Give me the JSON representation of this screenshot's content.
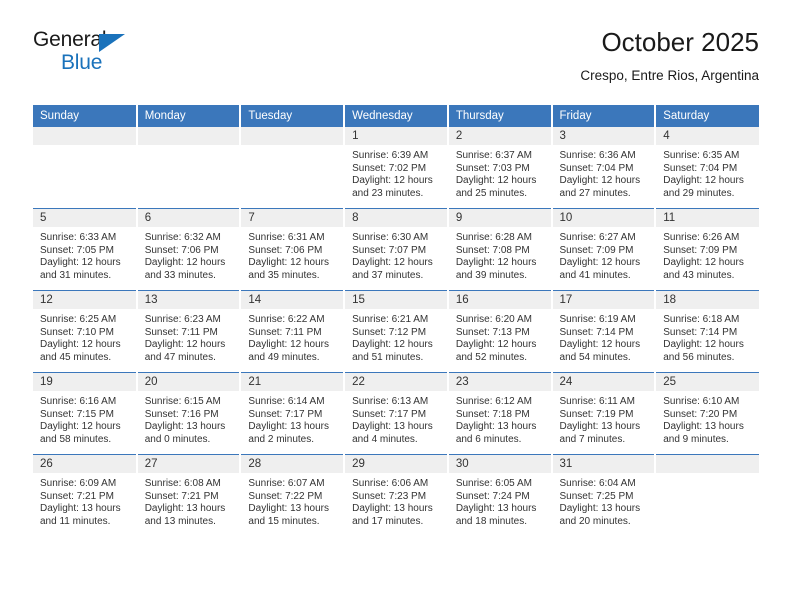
{
  "brand": {
    "name_part1": "General",
    "name_part2": "Blue",
    "accent_color": "#1a72bb"
  },
  "header": {
    "title": "October 2025",
    "subtitle": "Crespo, Entre Rios, Argentina"
  },
  "theme": {
    "header_blue": "#3b77bb",
    "daynum_gray": "#efefef"
  },
  "weekday_headers": [
    "Sunday",
    "Monday",
    "Tuesday",
    "Wednesday",
    "Thursday",
    "Friday",
    "Saturday"
  ],
  "weeks": [
    [
      {
        "day": "",
        "empty": true
      },
      {
        "day": "",
        "empty": true
      },
      {
        "day": "",
        "empty": true
      },
      {
        "day": "1",
        "sunrise": "Sunrise: 6:39 AM",
        "sunset": "Sunset: 7:02 PM",
        "daylight1": "Daylight: 12 hours",
        "daylight2": "and 23 minutes."
      },
      {
        "day": "2",
        "sunrise": "Sunrise: 6:37 AM",
        "sunset": "Sunset: 7:03 PM",
        "daylight1": "Daylight: 12 hours",
        "daylight2": "and 25 minutes."
      },
      {
        "day": "3",
        "sunrise": "Sunrise: 6:36 AM",
        "sunset": "Sunset: 7:04 PM",
        "daylight1": "Daylight: 12 hours",
        "daylight2": "and 27 minutes."
      },
      {
        "day": "4",
        "sunrise": "Sunrise: 6:35 AM",
        "sunset": "Sunset: 7:04 PM",
        "daylight1": "Daylight: 12 hours",
        "daylight2": "and 29 minutes."
      }
    ],
    [
      {
        "day": "5",
        "sunrise": "Sunrise: 6:33 AM",
        "sunset": "Sunset: 7:05 PM",
        "daylight1": "Daylight: 12 hours",
        "daylight2": "and 31 minutes."
      },
      {
        "day": "6",
        "sunrise": "Sunrise: 6:32 AM",
        "sunset": "Sunset: 7:06 PM",
        "daylight1": "Daylight: 12 hours",
        "daylight2": "and 33 minutes."
      },
      {
        "day": "7",
        "sunrise": "Sunrise: 6:31 AM",
        "sunset": "Sunset: 7:06 PM",
        "daylight1": "Daylight: 12 hours",
        "daylight2": "and 35 minutes."
      },
      {
        "day": "8",
        "sunrise": "Sunrise: 6:30 AM",
        "sunset": "Sunset: 7:07 PM",
        "daylight1": "Daylight: 12 hours",
        "daylight2": "and 37 minutes."
      },
      {
        "day": "9",
        "sunrise": "Sunrise: 6:28 AM",
        "sunset": "Sunset: 7:08 PM",
        "daylight1": "Daylight: 12 hours",
        "daylight2": "and 39 minutes."
      },
      {
        "day": "10",
        "sunrise": "Sunrise: 6:27 AM",
        "sunset": "Sunset: 7:09 PM",
        "daylight1": "Daylight: 12 hours",
        "daylight2": "and 41 minutes."
      },
      {
        "day": "11",
        "sunrise": "Sunrise: 6:26 AM",
        "sunset": "Sunset: 7:09 PM",
        "daylight1": "Daylight: 12 hours",
        "daylight2": "and 43 minutes."
      }
    ],
    [
      {
        "day": "12",
        "sunrise": "Sunrise: 6:25 AM",
        "sunset": "Sunset: 7:10 PM",
        "daylight1": "Daylight: 12 hours",
        "daylight2": "and 45 minutes."
      },
      {
        "day": "13",
        "sunrise": "Sunrise: 6:23 AM",
        "sunset": "Sunset: 7:11 PM",
        "daylight1": "Daylight: 12 hours",
        "daylight2": "and 47 minutes."
      },
      {
        "day": "14",
        "sunrise": "Sunrise: 6:22 AM",
        "sunset": "Sunset: 7:11 PM",
        "daylight1": "Daylight: 12 hours",
        "daylight2": "and 49 minutes."
      },
      {
        "day": "15",
        "sunrise": "Sunrise: 6:21 AM",
        "sunset": "Sunset: 7:12 PM",
        "daylight1": "Daylight: 12 hours",
        "daylight2": "and 51 minutes."
      },
      {
        "day": "16",
        "sunrise": "Sunrise: 6:20 AM",
        "sunset": "Sunset: 7:13 PM",
        "daylight1": "Daylight: 12 hours",
        "daylight2": "and 52 minutes."
      },
      {
        "day": "17",
        "sunrise": "Sunrise: 6:19 AM",
        "sunset": "Sunset: 7:14 PM",
        "daylight1": "Daylight: 12 hours",
        "daylight2": "and 54 minutes."
      },
      {
        "day": "18",
        "sunrise": "Sunrise: 6:18 AM",
        "sunset": "Sunset: 7:14 PM",
        "daylight1": "Daylight: 12 hours",
        "daylight2": "and 56 minutes."
      }
    ],
    [
      {
        "day": "19",
        "sunrise": "Sunrise: 6:16 AM",
        "sunset": "Sunset: 7:15 PM",
        "daylight1": "Daylight: 12 hours",
        "daylight2": "and 58 minutes."
      },
      {
        "day": "20",
        "sunrise": "Sunrise: 6:15 AM",
        "sunset": "Sunset: 7:16 PM",
        "daylight1": "Daylight: 13 hours",
        "daylight2": "and 0 minutes."
      },
      {
        "day": "21",
        "sunrise": "Sunrise: 6:14 AM",
        "sunset": "Sunset: 7:17 PM",
        "daylight1": "Daylight: 13 hours",
        "daylight2": "and 2 minutes."
      },
      {
        "day": "22",
        "sunrise": "Sunrise: 6:13 AM",
        "sunset": "Sunset: 7:17 PM",
        "daylight1": "Daylight: 13 hours",
        "daylight2": "and 4 minutes."
      },
      {
        "day": "23",
        "sunrise": "Sunrise: 6:12 AM",
        "sunset": "Sunset: 7:18 PM",
        "daylight1": "Daylight: 13 hours",
        "daylight2": "and 6 minutes."
      },
      {
        "day": "24",
        "sunrise": "Sunrise: 6:11 AM",
        "sunset": "Sunset: 7:19 PM",
        "daylight1": "Daylight: 13 hours",
        "daylight2": "and 7 minutes."
      },
      {
        "day": "25",
        "sunrise": "Sunrise: 6:10 AM",
        "sunset": "Sunset: 7:20 PM",
        "daylight1": "Daylight: 13 hours",
        "daylight2": "and 9 minutes."
      }
    ],
    [
      {
        "day": "26",
        "sunrise": "Sunrise: 6:09 AM",
        "sunset": "Sunset: 7:21 PM",
        "daylight1": "Daylight: 13 hours",
        "daylight2": "and 11 minutes."
      },
      {
        "day": "27",
        "sunrise": "Sunrise: 6:08 AM",
        "sunset": "Sunset: 7:21 PM",
        "daylight1": "Daylight: 13 hours",
        "daylight2": "and 13 minutes."
      },
      {
        "day": "28",
        "sunrise": "Sunrise: 6:07 AM",
        "sunset": "Sunset: 7:22 PM",
        "daylight1": "Daylight: 13 hours",
        "daylight2": "and 15 minutes."
      },
      {
        "day": "29",
        "sunrise": "Sunrise: 6:06 AM",
        "sunset": "Sunset: 7:23 PM",
        "daylight1": "Daylight: 13 hours",
        "daylight2": "and 17 minutes."
      },
      {
        "day": "30",
        "sunrise": "Sunrise: 6:05 AM",
        "sunset": "Sunset: 7:24 PM",
        "daylight1": "Daylight: 13 hours",
        "daylight2": "and 18 minutes."
      },
      {
        "day": "31",
        "sunrise": "Sunrise: 6:04 AM",
        "sunset": "Sunset: 7:25 PM",
        "daylight1": "Daylight: 13 hours",
        "daylight2": "and 20 minutes."
      },
      {
        "day": "",
        "empty": true
      }
    ]
  ]
}
